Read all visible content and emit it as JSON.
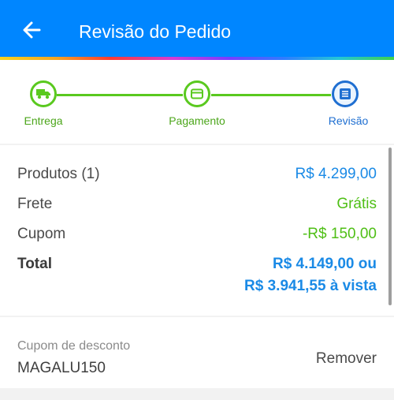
{
  "header": {
    "title": "Revisão do Pedido",
    "back_icon": "arrow-back-icon"
  },
  "colors": {
    "accent": "#0086ff",
    "step_complete": "#5ac91f",
    "step_active": "#1f6fd1",
    "value_blue": "#1a8ae6",
    "value_green": "#4fbf16"
  },
  "steps": [
    {
      "label": "Entrega",
      "icon": "truck-icon",
      "state": "complete"
    },
    {
      "label": "Pagamento",
      "icon": "card-icon",
      "state": "complete"
    },
    {
      "label": "Revisão",
      "icon": "list-icon",
      "state": "active"
    }
  ],
  "summary": {
    "products": {
      "label": "Produtos (1)",
      "value": "R$ 4.299,00"
    },
    "shipping": {
      "label": "Frete",
      "value": "Grátis"
    },
    "coupon": {
      "label": "Cupom",
      "value": "-R$ 150,00"
    },
    "total": {
      "label": "Total",
      "value_installment": "R$ 4.149,00 ou",
      "value_cash": "R$ 3.941,55 à vista"
    }
  },
  "discount": {
    "label": "Cupom de desconto",
    "code": "MAGALU150",
    "remove_label": "Remover"
  }
}
